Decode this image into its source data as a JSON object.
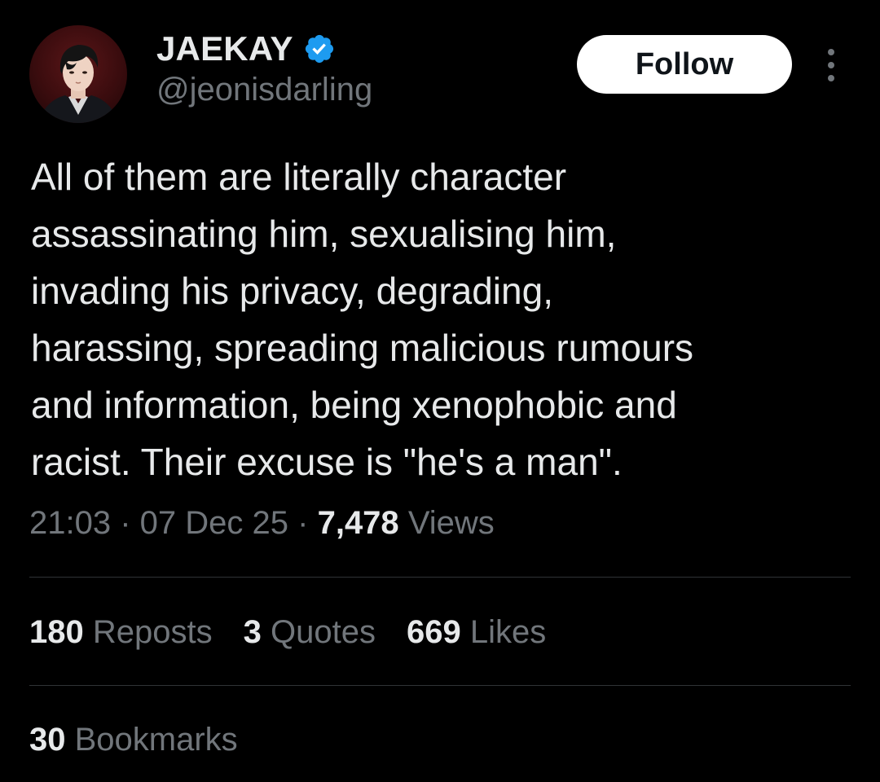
{
  "author": {
    "display_name": "JAEKAY",
    "handle": "@jeonisdarling",
    "verified_icon": "verified-badge-icon",
    "verified_color": "#1d9bf0"
  },
  "follow_label": "Follow",
  "more_icon": "more-vertical-icon",
  "tweet": {
    "text": "All of them are literally character\nassassinating him, sexualising him,\ninvading his privacy, degrading,\nharassing, spreading malicious rumours\nand information, being xenophobic and\nracist. Their excuse is \"he's a man\".",
    "time": "21:03",
    "date": "07 Dec 25",
    "views_count": "7,478",
    "views_label": "Views"
  },
  "stats": {
    "reposts_count": "180",
    "reposts_label": "Reposts",
    "quotes_count": "3",
    "quotes_label": "Quotes",
    "likes_count": "669",
    "likes_label": "Likes",
    "bookmarks_count": "30",
    "bookmarks_label": "Bookmarks"
  },
  "colors": {
    "background": "#000000",
    "primary_text": "#e7e9ea",
    "secondary_text": "#71767b",
    "divider": "#2f3336"
  }
}
